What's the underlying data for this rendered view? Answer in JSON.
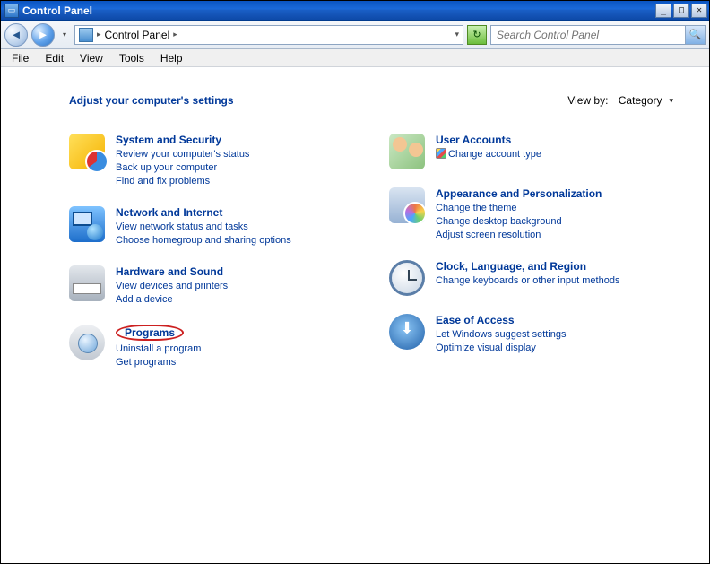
{
  "window": {
    "title": "Control Panel"
  },
  "address": {
    "path": "Control Panel"
  },
  "search": {
    "placeholder": "Search Control Panel"
  },
  "menu": {
    "file": "File",
    "edit": "Edit",
    "view": "View",
    "tools": "Tools",
    "help": "Help"
  },
  "content": {
    "heading": "Adjust your computer's settings",
    "viewby_label": "View by:",
    "viewby_value": "Category"
  },
  "categories": {
    "system": {
      "title": "System and Security",
      "links": [
        "Review your computer's status",
        "Back up your computer",
        "Find and fix problems"
      ]
    },
    "network": {
      "title": "Network and Internet",
      "links": [
        "View network status and tasks",
        "Choose homegroup and sharing options"
      ]
    },
    "hardware": {
      "title": "Hardware and Sound",
      "links": [
        "View devices and printers",
        "Add a device"
      ]
    },
    "programs": {
      "title": "Programs",
      "links": [
        "Uninstall a program",
        "Get programs"
      ]
    },
    "users": {
      "title": "User Accounts",
      "links": [
        "Change account type"
      ]
    },
    "appearance": {
      "title": "Appearance and Personalization",
      "links": [
        "Change the theme",
        "Change desktop background",
        "Adjust screen resolution"
      ]
    },
    "clock": {
      "title": "Clock, Language, and Region",
      "links": [
        "Change keyboards or other input methods"
      ]
    },
    "ease": {
      "title": "Ease of Access",
      "links": [
        "Let Windows suggest settings",
        "Optimize visual display"
      ]
    }
  }
}
